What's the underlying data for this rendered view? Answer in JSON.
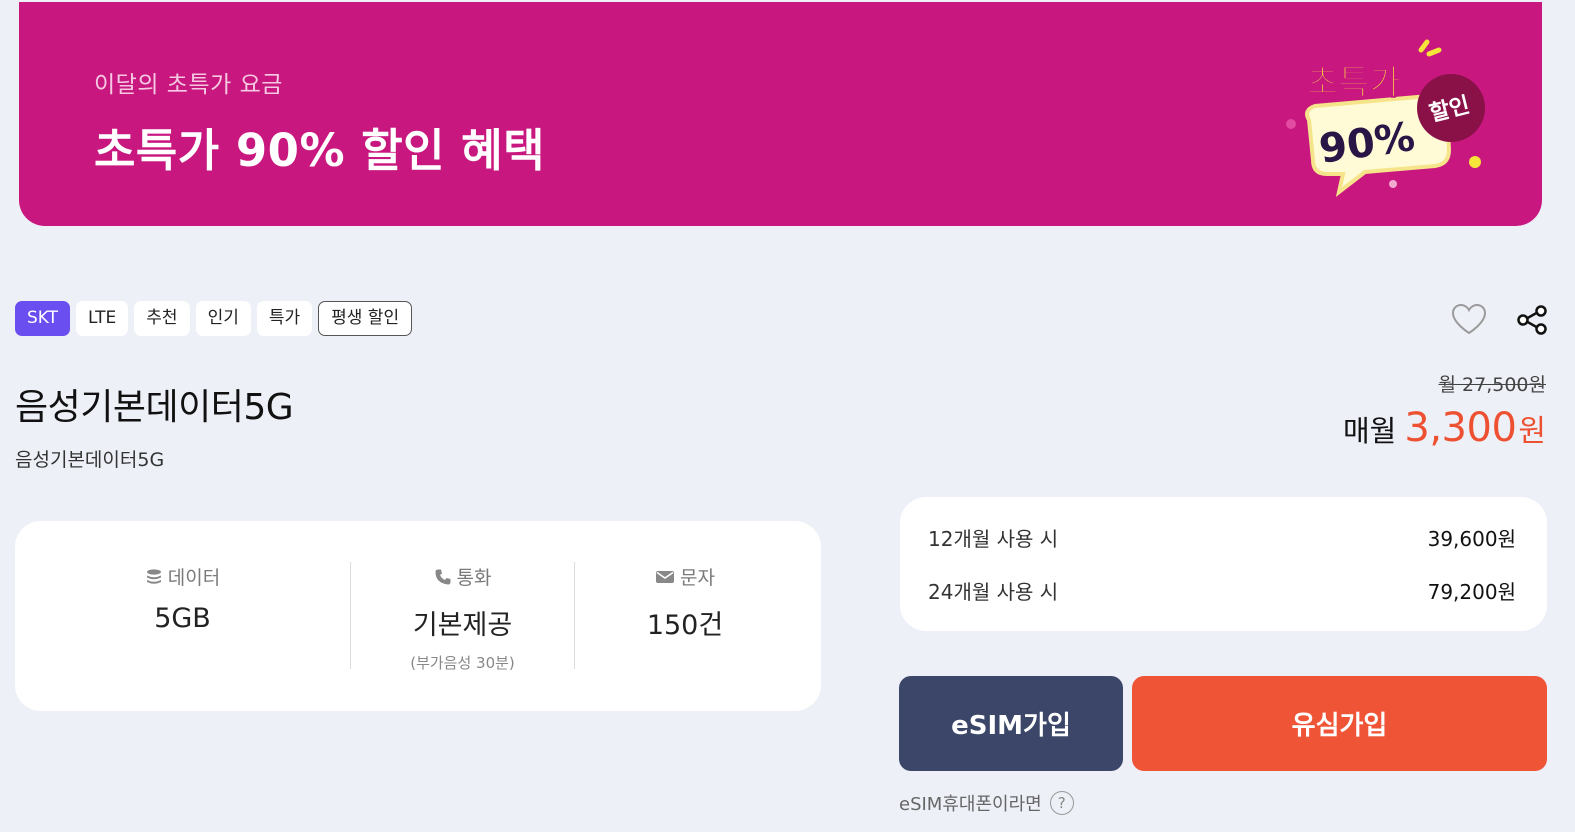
{
  "banner": {
    "subtitle": "이달의 초특가 요금",
    "title": "초특가 90% 할인 혜택",
    "badge_text": "초특가",
    "badge_percent": "90%",
    "badge_discount": "할인",
    "background_color": "#c8177f"
  },
  "tags": [
    {
      "label": "SKT",
      "style": "primary"
    },
    {
      "label": "LTE",
      "style": "default"
    },
    {
      "label": "추천",
      "style": "default"
    },
    {
      "label": "인기",
      "style": "default"
    },
    {
      "label": "특가",
      "style": "default"
    },
    {
      "label": "평생 할인",
      "style": "outline"
    }
  ],
  "actions": {
    "favorite_icon": "heart-icon",
    "share_icon": "share-icon"
  },
  "plan": {
    "title": "음성기본데이터5G",
    "subtitle": "음성기본데이터5G"
  },
  "price": {
    "original": "월 27,500원",
    "label": "매월",
    "value": "3,300",
    "unit": "원",
    "accent_color": "#ee5132"
  },
  "specs": [
    {
      "icon": "database-icon",
      "label": "데이터",
      "value": "5GB",
      "note": ""
    },
    {
      "icon": "phone-icon",
      "label": "통화",
      "value": "기본제공",
      "note": "(부가음성 30분)"
    },
    {
      "icon": "mail-icon",
      "label": "문자",
      "value": "150건",
      "note": ""
    }
  ],
  "costs": [
    {
      "label": "12개월 사용 시",
      "amount": "39,600원"
    },
    {
      "label": "24개월 사용 시",
      "amount": "79,200원"
    }
  ],
  "buttons": {
    "esim": "eSIM가입",
    "usim": "유심가입",
    "esim_color": "#3b4668",
    "usim_color": "#f05437"
  },
  "help": {
    "text": "eSIM휴대폰이라면",
    "icon": "question-icon"
  }
}
